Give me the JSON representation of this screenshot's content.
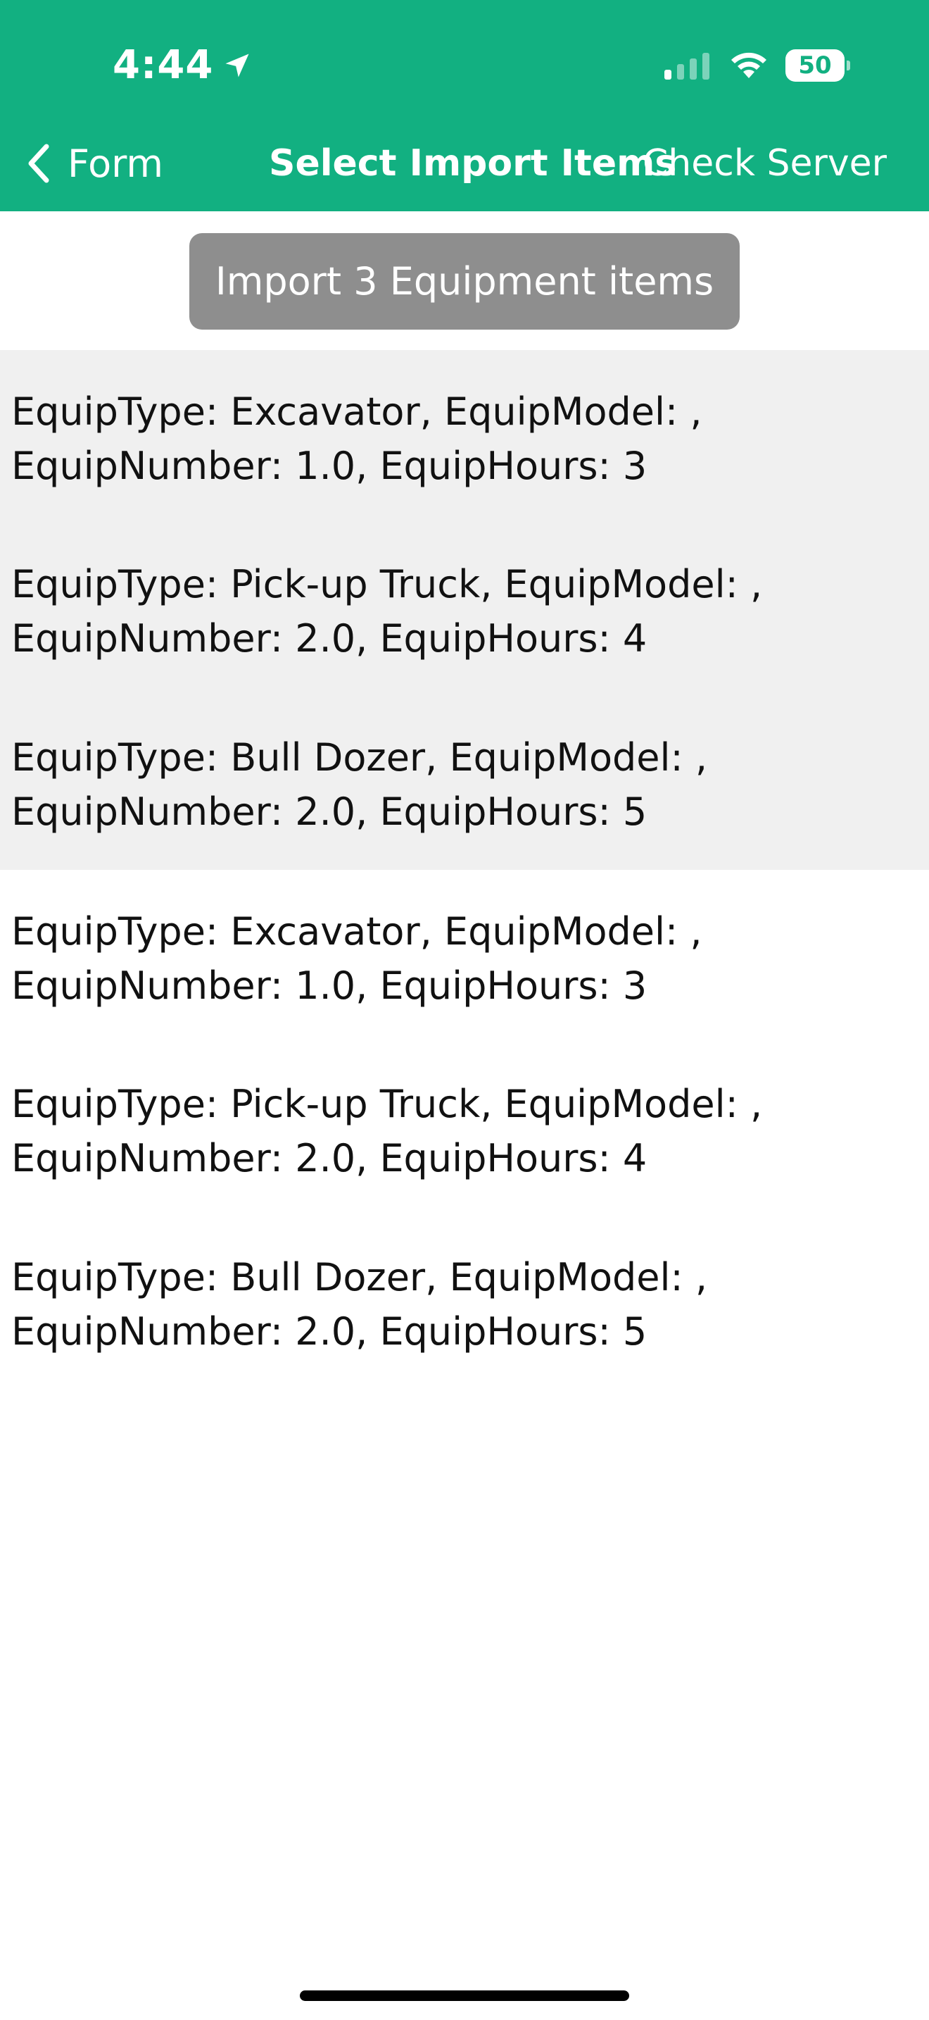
{
  "status_bar": {
    "time": "4:44",
    "battery": "50",
    "icons": [
      "location-arrow-icon",
      "signal-icon",
      "wifi-icon",
      "battery-icon"
    ]
  },
  "nav": {
    "back_label": "Form",
    "title": "Select Import Items",
    "right_action": "Check Server"
  },
  "import_button": {
    "label": "Import 3 Equipment items"
  },
  "selected_items": [
    {
      "line1": "EquipType: Excavator, EquipModel:  ,",
      "line2": "EquipNumber: 1.0, EquipHours: 3"
    },
    {
      "line1": "EquipType: Pick-up Truck, EquipModel:  ,",
      "line2": "EquipNumber: 2.0, EquipHours: 4"
    },
    {
      "line1": "EquipType: Bull Dozer, EquipModel:  ,",
      "line2": "EquipNumber: 2.0, EquipHours: 5"
    }
  ],
  "unselected_items": [
    {
      "line1": "EquipType: Excavator, EquipModel:  ,",
      "line2": "EquipNumber: 1.0, EquipHours: 3"
    },
    {
      "line1": "EquipType: Pick-up Truck, EquipModel:  ,",
      "line2": "EquipNumber: 2.0, EquipHours: 4"
    },
    {
      "line1": "EquipType: Bull Dozer, EquipModel:  ,",
      "line2": "EquipNumber: 2.0, EquipHours: 5"
    }
  ],
  "colors": {
    "header": "#12b081",
    "button": "#8e8e8e",
    "selected_row": "#f0f0f0"
  }
}
